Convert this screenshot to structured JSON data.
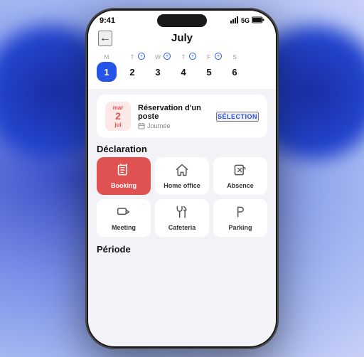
{
  "background": {
    "colors": [
      "#3a4fc8",
      "#7b8ee8"
    ]
  },
  "phone": {
    "statusBar": {
      "time": "9:41",
      "signal": "5G",
      "battery": "100"
    },
    "header": {
      "backLabel": "←",
      "title": "July"
    },
    "calendar": {
      "days": [
        {
          "label": "M",
          "num": "1",
          "active": true,
          "plus": false
        },
        {
          "label": "T",
          "num": "2",
          "active": false,
          "plus": true
        },
        {
          "label": "W",
          "num": "3",
          "active": false,
          "plus": true
        },
        {
          "label": "T",
          "num": "4",
          "active": false,
          "plus": true
        },
        {
          "label": "F",
          "num": "5",
          "active": false,
          "plus": true
        },
        {
          "label": "S",
          "num": "6",
          "active": false,
          "plus": false
        }
      ]
    },
    "reservation": {
      "dateDayLabel": "mar",
      "dateNum": "2",
      "dateMonth": "jui",
      "title": "Réservation d'un poste",
      "subIcon": "calendar",
      "subLabel": "Journée",
      "actionLabel": "SÉLECTION"
    },
    "declaration": {
      "sectionTitle": "Déclaration",
      "items": [
        {
          "id": "booking",
          "label": "Booking",
          "icon": "booking",
          "active": true
        },
        {
          "id": "home-office",
          "label": "Home office",
          "icon": "home",
          "active": false
        },
        {
          "id": "absence",
          "label": "Absence",
          "icon": "absence",
          "active": false
        },
        {
          "id": "meeting",
          "label": "Meeting",
          "icon": "meeting",
          "active": false
        },
        {
          "id": "cafeteria",
          "label": "Cafeteria",
          "icon": "cafeteria",
          "active": false
        },
        {
          "id": "parking",
          "label": "Parking",
          "icon": "parking",
          "active": false
        }
      ]
    },
    "periode": {
      "sectionTitle": "Période"
    }
  }
}
